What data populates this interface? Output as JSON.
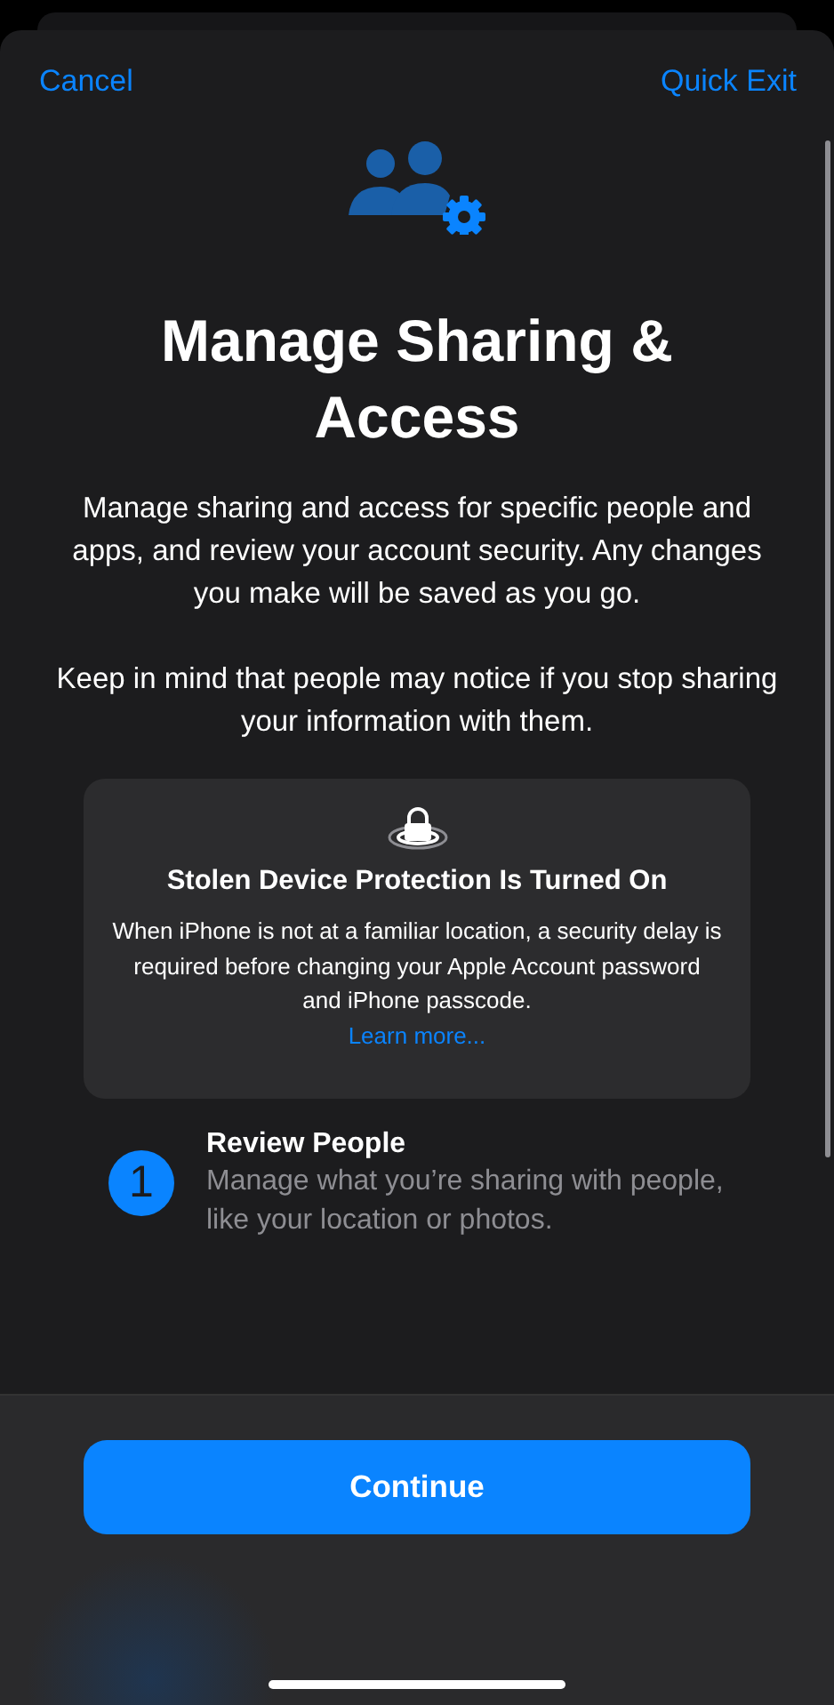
{
  "nav": {
    "cancel": "Cancel",
    "quick_exit": "Quick Exit"
  },
  "title": "Manage Sharing & Access",
  "paragraphs": [
    "Manage sharing and access for specific people and apps, and review your account security. Any changes you make will be saved as you go.",
    "Keep in mind that people may notice if you stop sharing your information with them."
  ],
  "notice": {
    "title": "Stolen Device Protection Is Turned On",
    "body": "When iPhone is not at a familiar location, a security delay is required before changing your Apple Account password and iPhone passcode.",
    "link": "Learn more..."
  },
  "steps": [
    {
      "number": "1",
      "title": "Review People",
      "description": "Manage what you’re sharing with people, like your location or photos."
    }
  ],
  "primary_button": "Continue"
}
